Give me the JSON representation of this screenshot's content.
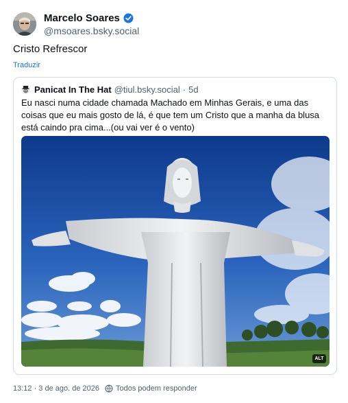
{
  "author": {
    "display_name": "Marcelo Soares",
    "handle": "@msoares.bsky.social",
    "verified_icon": "verified-badge-icon"
  },
  "post": {
    "text": "Cristo Refrescor",
    "translate_label": "Traduzir"
  },
  "quote": {
    "display_name": "Panicat In The Hat",
    "handle": "@tiul.bsky.social",
    "separator": "·",
    "time": "5d",
    "text": "Eu nasci numa cidade chamada Machado em Minhas Gerais, e uma das coisas que eu mais gosto de lá, é que tem um Cristo que a manha da blusa está caindo pra cima...(ou vai ver é o vento)",
    "image_alt_badge": "ALT"
  },
  "footer": {
    "timestamp": "13:12 · 3 de ago. de 2026",
    "reply_setting": "Todos podem responder",
    "reply_icon": "globe-icon"
  },
  "colors": {
    "accent": "#1c74e0",
    "muted": "#52606d",
    "border": "#d4dbe2"
  }
}
